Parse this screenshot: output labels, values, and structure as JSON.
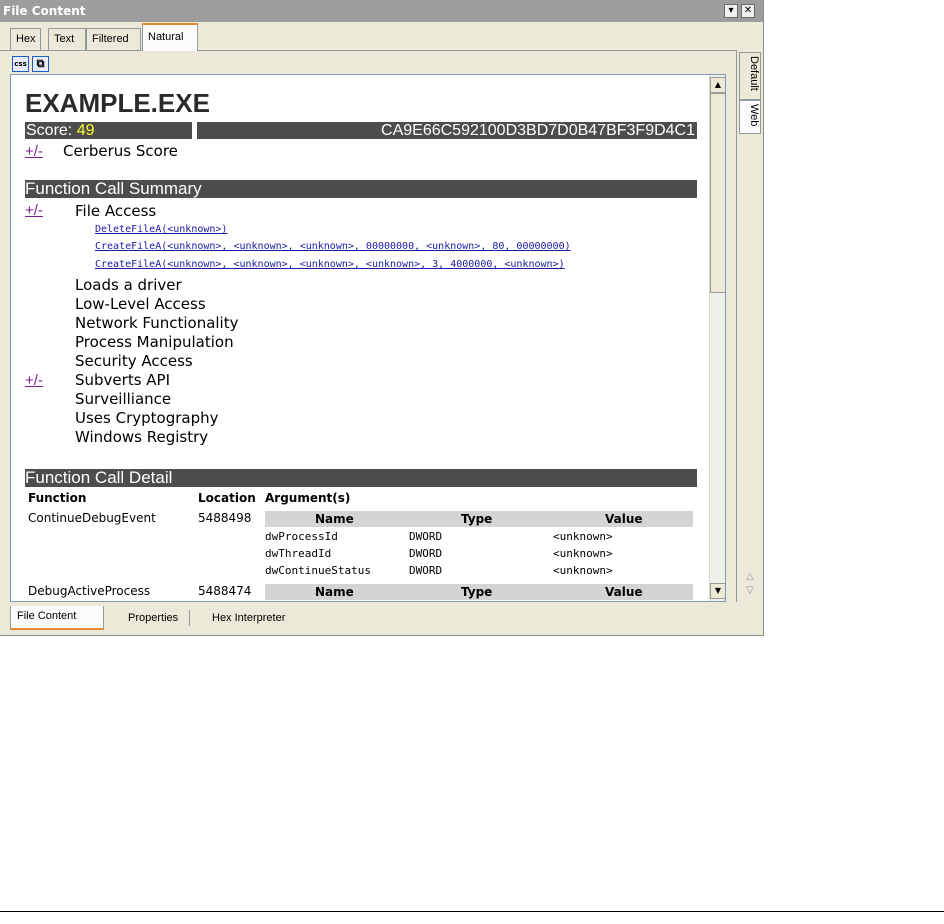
{
  "window": {
    "title": "File Content",
    "dropdown_btn": "▾",
    "close_btn": "✕"
  },
  "top_tabs": [
    "Hex",
    "Text",
    "Filtered",
    "Natural"
  ],
  "active_top_tab": "Natural",
  "toolbar": {
    "icon1": "css",
    "icon2": "⧉"
  },
  "side_tabs": [
    "Default",
    "Web"
  ],
  "bottom_tabs": [
    "File Content",
    "Properties",
    "Hex Interpreter"
  ],
  "report": {
    "title": "EXAMPLE.EXE",
    "score_label": "Score: ",
    "score_value": "49",
    "hash": "CA9E66C592100D3BD7D0B47BF3F9D4C1",
    "toggle": "+/-",
    "cerberus": "Cerberus Score",
    "summary_title": "Function Call Summary",
    "file_access": "File Access",
    "calls": [
      "DeleteFileA(<unknown>)",
      "CreateFileA(<unknown>, <unknown>, <unknown>, 00000000, <unknown>, 80, 00000000)",
      "CreateFileA(<unknown>, <unknown>, <unknown>, <unknown>, 3, 4000000, <unknown>)"
    ],
    "categories": [
      "Loads a driver",
      "Low-Level Access",
      "Network Functionality",
      "Process Manipulation",
      "Security Access",
      "Subverts API",
      "Surveilliance",
      "Uses Cryptography",
      "Windows Registry"
    ],
    "detail_title": "Function Call Detail",
    "detail_headers": {
      "function": "Function",
      "location": "Location",
      "arguments": "Argument(s)"
    },
    "arg_headers": {
      "name": "Name",
      "type": "Type",
      "value": "Value"
    },
    "detail_rows": [
      {
        "function": "ContinueDebugEvent",
        "location": "5488498",
        "args": [
          {
            "name": "dwProcessId",
            "type": "DWORD",
            "value": "<unknown>"
          },
          {
            "name": "dwThreadId",
            "type": "DWORD",
            "value": "<unknown>"
          },
          {
            "name": "dwContinueStatus",
            "type": "DWORD",
            "value": "<unknown>"
          }
        ]
      },
      {
        "function": "DebugActiveProcess",
        "location": "5488474"
      }
    ]
  },
  "colors": {
    "bar": "#4d4d4d",
    "score_value": "#ffff33",
    "toggle": "#7a1f8c",
    "link": "#1a1aa6",
    "tab_accent": "#e68b2c"
  }
}
